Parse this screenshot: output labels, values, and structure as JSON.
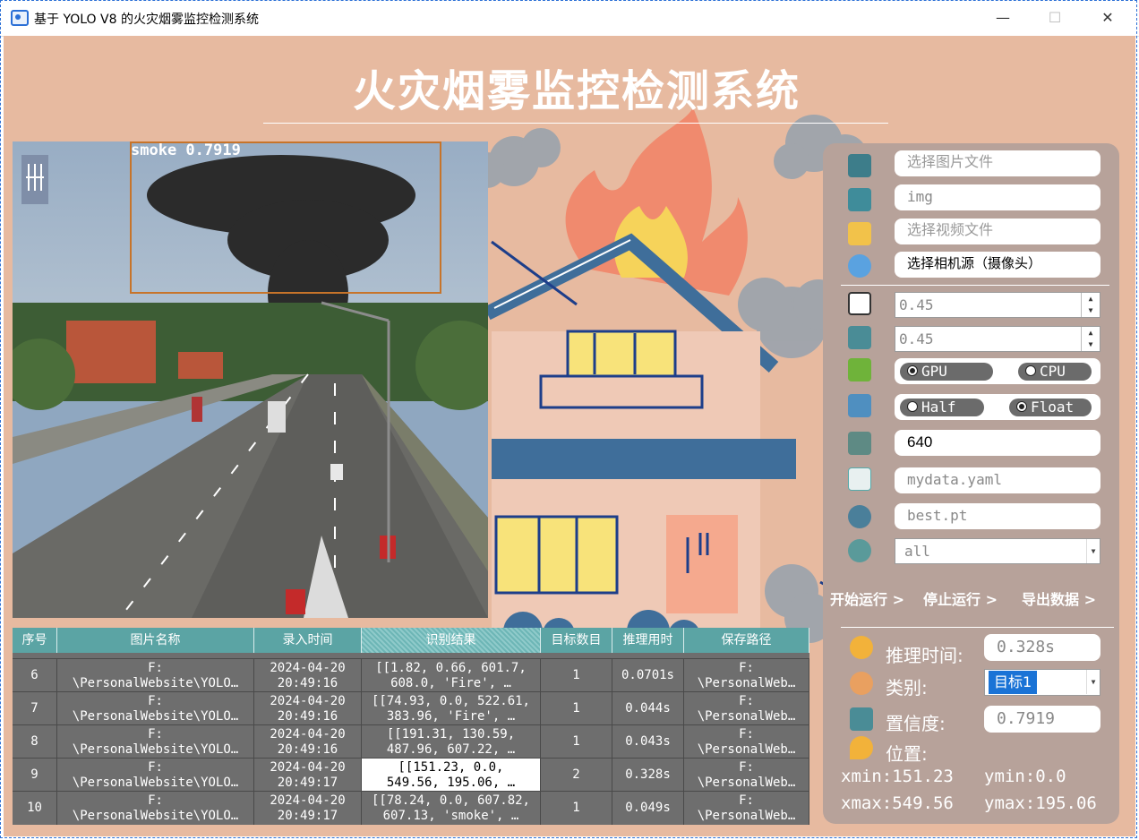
{
  "window": {
    "title": "基于 YOLO V8 的火灾烟雾监控检测系统",
    "minimize": "—",
    "maximize": "☐",
    "close": "✕"
  },
  "header": {
    "title": "火灾烟雾监控检测系统"
  },
  "detection": {
    "label": "smoke 0.7919"
  },
  "table": {
    "headers": [
      "序号",
      "图片名称",
      "录入时间",
      "识别结果",
      "目标数目",
      "推理用时",
      "保存路径"
    ],
    "rows": [
      {
        "index": "6",
        "name": "F:\n\\PersonalWebsite\\YOLO…",
        "time": "2024-04-20\n20:49:16",
        "result": "[[1.82, 0.66, 601.7,\n608.0, 'Fire', …",
        "count": "1",
        "elapsed": "0.0701s",
        "path": "F:\n\\PersonalWeb…"
      },
      {
        "index": "7",
        "name": "F:\n\\PersonalWebsite\\YOLO…",
        "time": "2024-04-20\n20:49:16",
        "result": "[[74.93, 0.0, 522.61,\n383.96, 'Fire', …",
        "count": "1",
        "elapsed": "0.044s",
        "path": "F:\n\\PersonalWeb…"
      },
      {
        "index": "8",
        "name": "F:\n\\PersonalWebsite\\YOLO…",
        "time": "2024-04-20\n20:49:16",
        "result": "[[191.31, 130.59,\n487.96, 607.22, …",
        "count": "1",
        "elapsed": "0.043s",
        "path": "F:\n\\PersonalWeb…"
      },
      {
        "index": "9",
        "name": "F:\n\\PersonalWebsite\\YOLO…",
        "time": "2024-04-20\n20:49:17",
        "result": "[[151.23, 0.0,\n549.56, 195.06, …",
        "count": "2",
        "elapsed": "0.328s",
        "path": "F:\n\\PersonalWeb…"
      },
      {
        "index": "10",
        "name": "F:\n\\PersonalWebsite\\YOLO…",
        "time": "2024-04-20\n20:49:17",
        "result": "[[78.24, 0.0, 607.82,\n607.13, 'smoke', …",
        "count": "1",
        "elapsed": "0.049s",
        "path": "F:\n\\PersonalWeb…"
      }
    ]
  },
  "panel": {
    "select_image": "选择图片文件",
    "img_folder": "img",
    "select_video": "选择视频文件",
    "select_camera": "选择相机源（摄像头）",
    "conf": "0.45",
    "iou": "0.45",
    "device_gpu": "GPU",
    "device_cpu": "CPU",
    "precision_half": "Half",
    "precision_float": "Float",
    "img_size": "640",
    "data_yaml": "mydata.yaml",
    "weights": "best.pt",
    "classes": "all",
    "start": "开始运行 >",
    "stop": "停止运行 >",
    "export": "导出数据 >"
  },
  "info": {
    "time_label": "推理时间:",
    "time_value": "0.328s",
    "class_label": "类别:",
    "class_value": "目标1",
    "conf_label": "置信度:",
    "conf_value": "0.7919",
    "pos_label": "位置:",
    "xmin": "xmin:151.23",
    "ymin": "ymin:0.0",
    "xmax": "xmax:549.56",
    "ymax": "ymax:195.06"
  }
}
